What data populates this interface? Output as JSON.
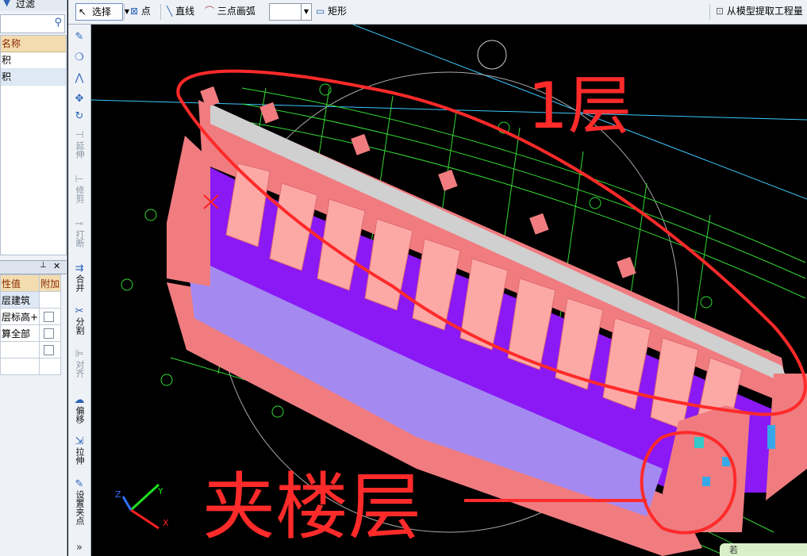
{
  "left_panel": {
    "filter_label": "过滤",
    "list_header": "名称",
    "list_items": [
      "积",
      "积"
    ],
    "properties": {
      "headers": [
        "性值",
        "附加"
      ],
      "rows": [
        {
          "value": "层建筑"
        },
        {
          "value": "层标高+"
        },
        {
          "value": "算全部"
        },
        {
          "value": ""
        }
      ]
    }
  },
  "toolbar": {
    "select_label": "选择",
    "point_label": "点",
    "line_label": "直线",
    "arc_label": "三点画弧",
    "rect_label": "矩形",
    "extract_label": "从模型提取工程量"
  },
  "vtoolbar": {
    "items": [
      {
        "label": "延伸"
      },
      {
        "label": "修剪"
      },
      {
        "label": "打断"
      },
      {
        "label": "合并"
      },
      {
        "label": "分割"
      },
      {
        "label": "对齐"
      },
      {
        "label": "偏移"
      },
      {
        "label": "拉伸"
      },
      {
        "label": "设置夹点"
      }
    ]
  },
  "canvas": {
    "axis_labels": {
      "x": "X",
      "y": "Y",
      "z": "Z"
    },
    "annotation_top": "1层",
    "annotation_bottom": "夹楼层",
    "corner_text": "若"
  },
  "colors": {
    "background": "#000000",
    "building_wall": "#f07c80",
    "building_roof": "#fca9a6",
    "floor_purple": "#8a19f5",
    "grid_green": "#33d933",
    "annotation_red": "#ff2a2a"
  }
}
